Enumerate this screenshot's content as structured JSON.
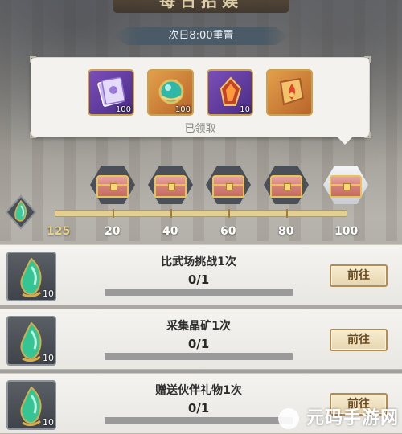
{
  "header": {
    "title": "每日招娱",
    "reset_text": "次日8:00重置"
  },
  "reward_panel": {
    "items": [
      {
        "icon": "purple-book-icon",
        "count": "100",
        "rarity_color": "#7b4fb8"
      },
      {
        "icon": "jade-orb-icon",
        "count": "100",
        "rarity_color": "#e3a04a"
      },
      {
        "icon": "fire-crystal-icon",
        "count": "10",
        "rarity_color": "#7b4fb8"
      },
      {
        "icon": "flame-badge-icon",
        "count": "",
        "rarity_color": "#e3a04a"
      }
    ],
    "status": "已领取"
  },
  "activity": {
    "current_points": "125",
    "milestones": [
      "20",
      "40",
      "60",
      "80",
      "100"
    ],
    "progress_fraction": 1.0,
    "track_color": "#e4cf92"
  },
  "tasks": [
    {
      "title": "比武场挑战1次",
      "progress": "0/1",
      "reward_count": "10",
      "progress_fraction": 0,
      "button": "前往"
    },
    {
      "title": "采集晶矿1次",
      "progress": "0/1",
      "reward_count": "10",
      "progress_fraction": 0,
      "button": "前往"
    },
    {
      "title": "赠送伙伴礼物1次",
      "progress": "0/1",
      "reward_count": "10",
      "progress_fraction": 0,
      "button": "前往"
    }
  ],
  "watermark": "元码手游网"
}
